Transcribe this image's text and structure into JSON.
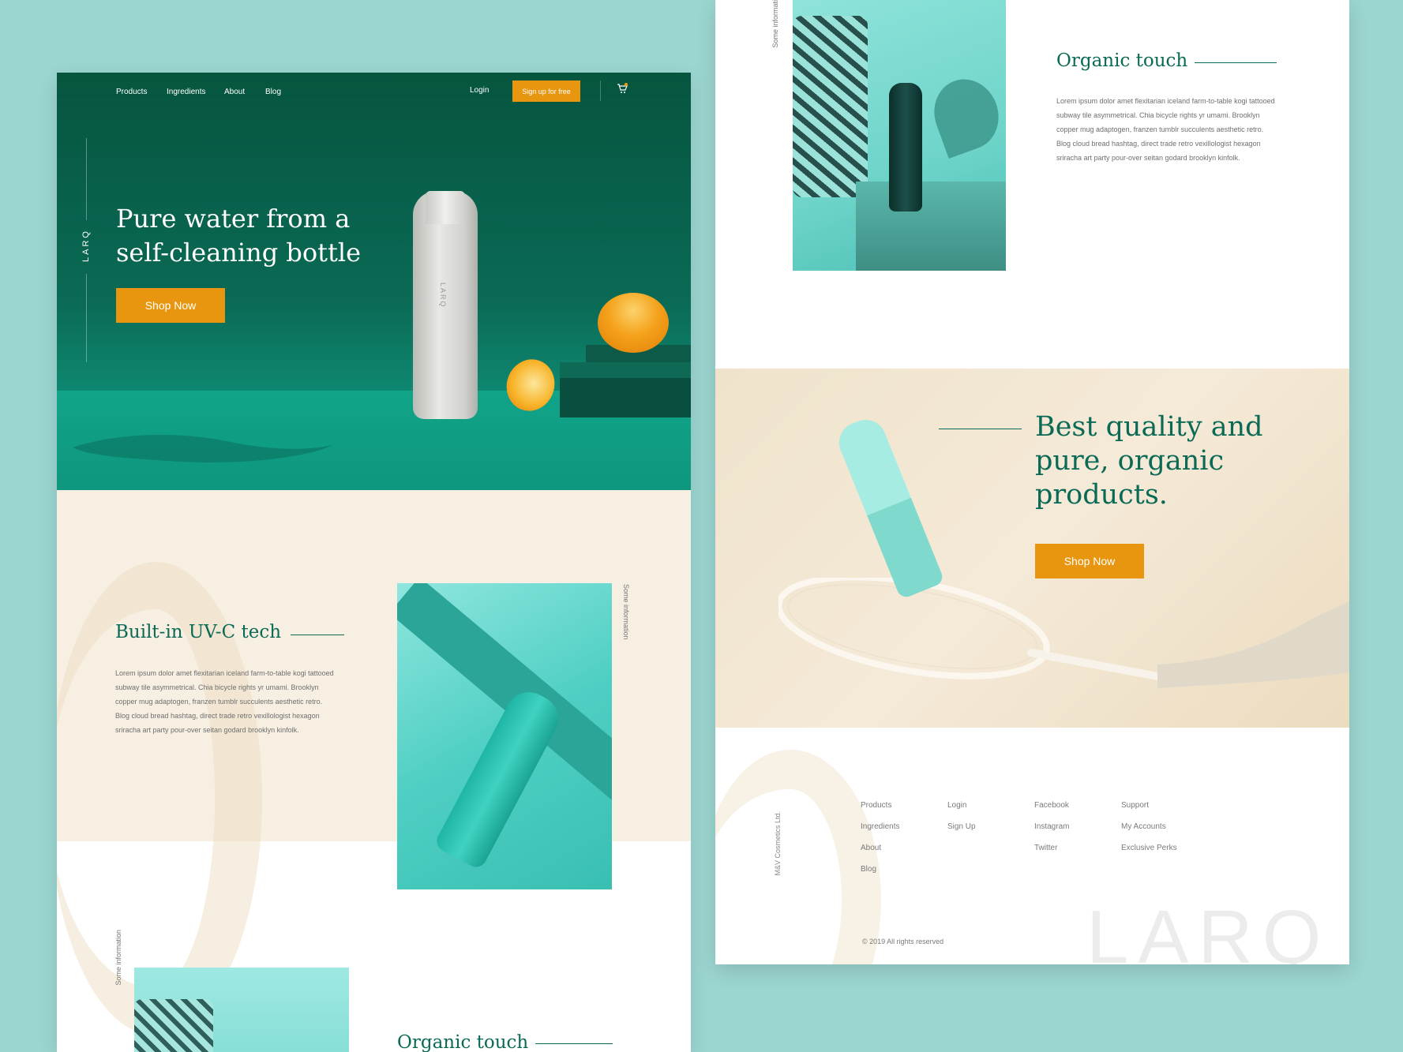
{
  "nav": {
    "links": [
      "Products",
      "Ingredients",
      "About",
      "Blog"
    ],
    "login": "Login",
    "signup": "Sign up for free",
    "cart_icon": "cart-icon"
  },
  "brand": {
    "side_logo": "LARQ",
    "bottle_logo": "LARQ",
    "footer_watermark": "LARQ"
  },
  "hero": {
    "title_line1": "Pure water from a",
    "title_line2": "self-cleaning bottle",
    "cta": "Shop Now"
  },
  "uv_section": {
    "title": "Built-in UV-C tech",
    "body": "Lorem ipsum dolor amet flexitarian iceland farm-to-table kogi tattooed subway tile asymmetrical. Chia bicycle rights yr umami. Brooklyn copper mug adaptogen, franzen tumblr succulents aesthetic retro. Blog cloud bread hashtag, direct trade retro vexillologist hexagon sriracha art party pour-over seitan godard brooklyn kinfolk.",
    "side_note": "Some information"
  },
  "organic_left": {
    "title": "Organic touch",
    "side_note": "Some information"
  },
  "organic_right": {
    "title": "Organic touch",
    "body": "Lorem ipsum dolor amet flexitarian iceland farm-to-table kogi tattooed subway tile asymmetrical. Chia bicycle rights yr umami. Brooklyn copper mug adaptogen, franzen tumblr succulents aesthetic retro. Blog cloud bread hashtag, direct trade retro vexillologist hexagon sriracha art party pour-over seitan godard brooklyn kinfolk.",
    "side_note": "Some informati"
  },
  "quality": {
    "line1": "Best quality and",
    "line2": "pure, organic",
    "line3": "products.",
    "cta": "Shop Now"
  },
  "footer": {
    "company": "M&V Cosmetics Ltd.",
    "col1": [
      "Products",
      "Ingredients",
      "About",
      "Blog"
    ],
    "col2": [
      "Login",
      "Sign Up"
    ],
    "col3": [
      "Facebook",
      "Instagram",
      "Twitter"
    ],
    "col4": [
      "Support",
      "My Accounts",
      "Exclusive Perks"
    ],
    "copyright": "© 2019 All rights reserved"
  },
  "colors": {
    "background": "#9cd6d1",
    "hero_green": "#0a6a55",
    "accent_orange": "#e8960f",
    "beige": "#f6efe2",
    "cream": "#efe3cb"
  }
}
